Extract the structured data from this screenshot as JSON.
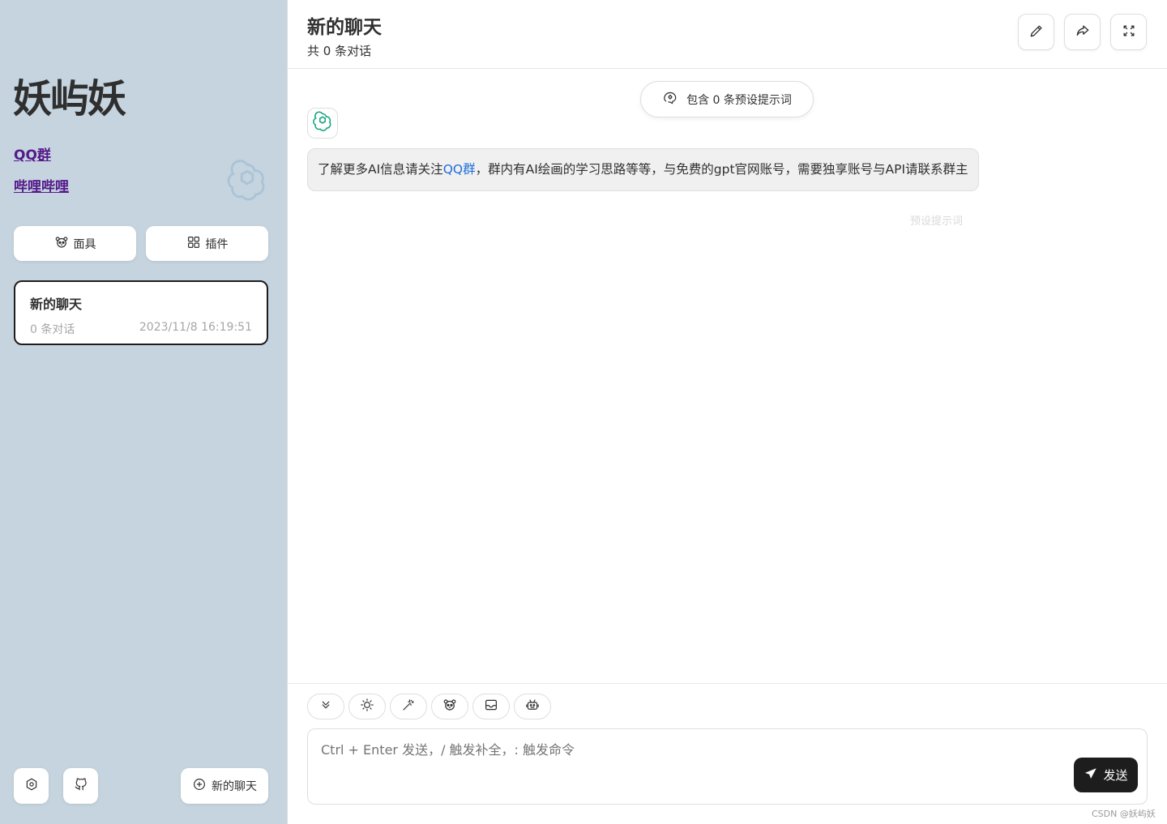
{
  "sidebar": {
    "title": "妖屿妖",
    "links": [
      "QQ群",
      "哔哩哔哩"
    ],
    "mask_label": "面具",
    "plugin_label": "插件",
    "chat_list": [
      {
        "title": "新的聊天",
        "count": "0 条对话",
        "time": "2023/11/8 16:19:51"
      }
    ],
    "new_chat_label": "新的聊天"
  },
  "header": {
    "title": "新的聊天",
    "subtitle": "共 0 条对话"
  },
  "chat": {
    "prompt_toast": "包含 0 条预设提示词",
    "message_parts": {
      "before": "了解更多AI信息请关注",
      "link": "QQ群",
      "after": "，群内有AI绘画的学习思路等等，与免费的gpt官网账号，需要独享账号与API请联系群主"
    },
    "message_date": "预设提示词"
  },
  "input": {
    "placeholder": "Ctrl + Enter 发送，/ 触发补全，: 触发命令",
    "send_label": "发送",
    "tools": [
      "chevron-double-down-icon",
      "brightness-icon",
      "magic-wand-icon",
      "mask-icon",
      "image-icon",
      "robot-icon"
    ]
  },
  "watermark": "CSDN @妖屿妖",
  "colors": {
    "sidebar_bg": "#c6d4df",
    "link": "#551a8b",
    "chat_link": "#1d6fd8",
    "send_bg": "#1d1d1d"
  }
}
